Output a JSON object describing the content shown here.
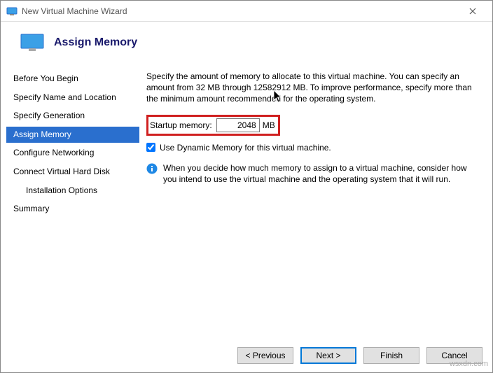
{
  "window": {
    "title": "New Virtual Machine Wizard"
  },
  "header": {
    "title": "Assign Memory"
  },
  "sidebar": {
    "items": [
      {
        "label": "Before You Begin"
      },
      {
        "label": "Specify Name and Location"
      },
      {
        "label": "Specify Generation"
      },
      {
        "label": "Assign Memory"
      },
      {
        "label": "Configure Networking"
      },
      {
        "label": "Connect Virtual Hard Disk"
      },
      {
        "label": "Installation Options"
      },
      {
        "label": "Summary"
      }
    ],
    "selected_index": 3
  },
  "content": {
    "description": "Specify the amount of memory to allocate to this virtual machine. You can specify an amount from 32 MB through 12582912 MB. To improve performance, specify more than the minimum amount recommended for the operating system.",
    "memory_label": "Startup memory:",
    "memory_value": "2048",
    "memory_unit": "MB",
    "dynamic_checked": true,
    "dynamic_label": "Use Dynamic Memory for this virtual machine.",
    "info_text": "When you decide how much memory to assign to a virtual machine, consider how you intend to use the virtual machine and the operating system that it will run."
  },
  "footer": {
    "previous": "< Previous",
    "next": "Next >",
    "finish": "Finish",
    "cancel": "Cancel"
  },
  "watermark": "wsxdn.com"
}
